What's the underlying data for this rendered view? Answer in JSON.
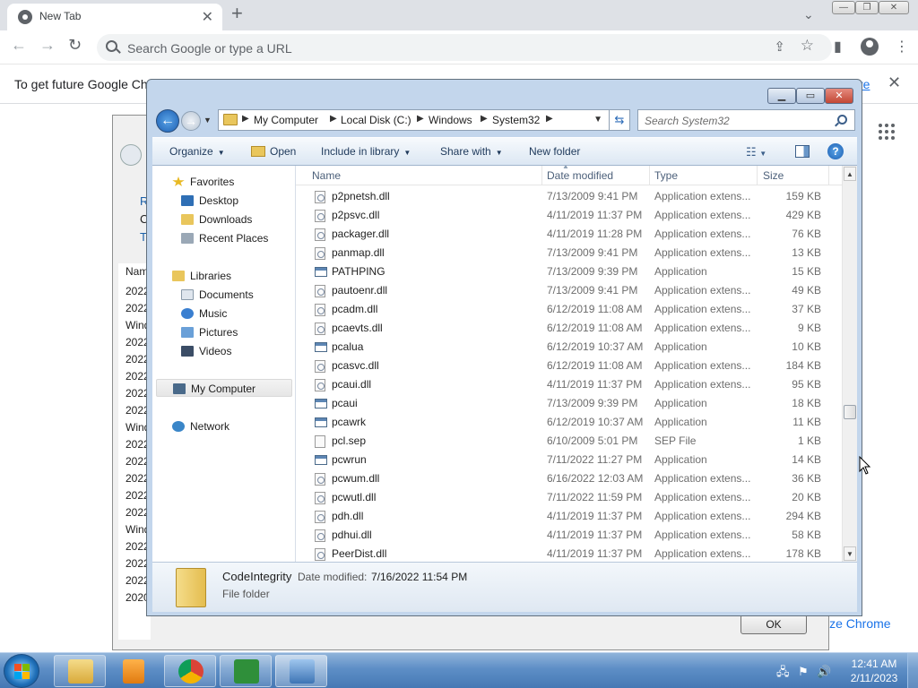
{
  "browser": {
    "tab_title": "New Tab",
    "tab_close": "✕",
    "new_tab": "+",
    "tab_search": "⌄",
    "omnibox_placeholder": "Search Google or type a URL",
    "infobar_text": "To get future Google Chro",
    "infobar_link": "re",
    "infobar_close": "✕",
    "customize_label": "ize Chrome",
    "win_minimize": "—",
    "win_restore": "❐",
    "win_close": "✕"
  },
  "background_dialog": {
    "side_text": [
      "R",
      "C",
      "T"
    ],
    "list_header": "Nam",
    "list_items": [
      "2022",
      "2022",
      "Wind",
      "2022",
      "2022",
      "2022",
      "2022",
      "2022",
      "Wind",
      "2022",
      "2022",
      "2022",
      "2022",
      "2022",
      "Wind",
      "2022",
      "2022",
      "2022",
      "2020"
    ],
    "ok_label": "OK"
  },
  "explorer": {
    "breadcrumb": [
      "My Computer",
      "Local Disk (C:)",
      "Windows",
      "System32"
    ],
    "search_placeholder": "Search System32",
    "commands": {
      "organize": "Organize",
      "open": "Open",
      "include_in_library": "Include in library",
      "share_with": "Share with",
      "new_folder": "New folder"
    },
    "nav": {
      "favorites": "Favorites",
      "desktop": "Desktop",
      "downloads": "Downloads",
      "recent_places": "Recent Places",
      "libraries": "Libraries",
      "documents": "Documents",
      "music": "Music",
      "pictures": "Pictures",
      "videos": "Videos",
      "my_computer": "My Computer",
      "network": "Network"
    },
    "columns": {
      "name": "Name",
      "date_modified": "Date modified",
      "type": "Type",
      "size": "Size"
    },
    "files": [
      {
        "name": "p2pnetsh.dll",
        "date": "7/13/2009 9:41 PM",
        "type": "Application extens...",
        "size": "159 KB",
        "kind": "dll"
      },
      {
        "name": "p2psvc.dll",
        "date": "4/11/2019 11:37 PM",
        "type": "Application extens...",
        "size": "429 KB",
        "kind": "dll"
      },
      {
        "name": "packager.dll",
        "date": "4/11/2019 11:28 PM",
        "type": "Application extens...",
        "size": "76 KB",
        "kind": "dll"
      },
      {
        "name": "panmap.dll",
        "date": "7/13/2009 9:41 PM",
        "type": "Application extens...",
        "size": "13 KB",
        "kind": "dll"
      },
      {
        "name": "PATHPING",
        "date": "7/13/2009 9:39 PM",
        "type": "Application",
        "size": "15 KB",
        "kind": "app"
      },
      {
        "name": "pautoenr.dll",
        "date": "7/13/2009 9:41 PM",
        "type": "Application extens...",
        "size": "49 KB",
        "kind": "dll"
      },
      {
        "name": "pcadm.dll",
        "date": "6/12/2019 11:08 AM",
        "type": "Application extens...",
        "size": "37 KB",
        "kind": "dll"
      },
      {
        "name": "pcaevts.dll",
        "date": "6/12/2019 11:08 AM",
        "type": "Application extens...",
        "size": "9 KB",
        "kind": "dll"
      },
      {
        "name": "pcalua",
        "date": "6/12/2019 10:37 AM",
        "type": "Application",
        "size": "10 KB",
        "kind": "app"
      },
      {
        "name": "pcasvc.dll",
        "date": "6/12/2019 11:08 AM",
        "type": "Application extens...",
        "size": "184 KB",
        "kind": "dll"
      },
      {
        "name": "pcaui.dll",
        "date": "4/11/2019 11:37 PM",
        "type": "Application extens...",
        "size": "95 KB",
        "kind": "dll"
      },
      {
        "name": "pcaui",
        "date": "7/13/2009 9:39 PM",
        "type": "Application",
        "size": "18 KB",
        "kind": "app"
      },
      {
        "name": "pcawrk",
        "date": "6/12/2019 10:37 AM",
        "type": "Application",
        "size": "11 KB",
        "kind": "app"
      },
      {
        "name": "pcl.sep",
        "date": "6/10/2009 5:01 PM",
        "type": "SEP File",
        "size": "1 KB",
        "kind": "file"
      },
      {
        "name": "pcwrun",
        "date": "7/11/2022 11:27 PM",
        "type": "Application",
        "size": "14 KB",
        "kind": "app"
      },
      {
        "name": "pcwum.dll",
        "date": "6/16/2022 12:03 AM",
        "type": "Application extens...",
        "size": "36 KB",
        "kind": "dll"
      },
      {
        "name": "pcwutl.dll",
        "date": "7/11/2022 11:59 PM",
        "type": "Application extens...",
        "size": "20 KB",
        "kind": "dll"
      },
      {
        "name": "pdh.dll",
        "date": "4/11/2019 11:37 PM",
        "type": "Application extens...",
        "size": "294 KB",
        "kind": "dll"
      },
      {
        "name": "pdhui.dll",
        "date": "4/11/2019 11:37 PM",
        "type": "Application extens...",
        "size": "58 KB",
        "kind": "dll"
      },
      {
        "name": "PeerDist.dll",
        "date": "4/11/2019 11:37 PM",
        "type": "Application extens...",
        "size": "178 KB",
        "kind": "dll"
      }
    ],
    "details": {
      "name": "CodeIntegrity",
      "date_label": "Date modified:",
      "date": "7/16/2022 11:54 PM",
      "type": "File folder"
    }
  },
  "taskbar": {
    "time": "12:41 AM",
    "date": "2/11/2023"
  },
  "colors": {
    "chrome_link": "#1a73e8",
    "explorer_frame": "#c3d6ec",
    "taskbar": "#5d8ec6"
  }
}
